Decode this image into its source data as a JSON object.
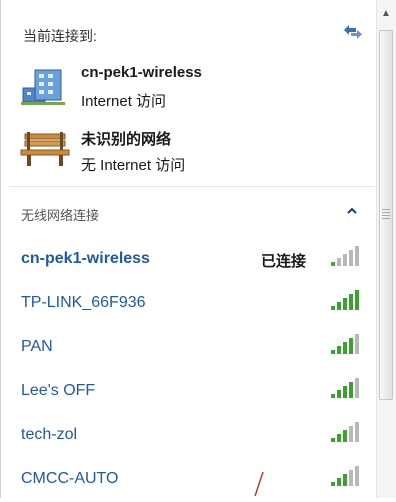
{
  "header": {
    "current_title": "当前连接到:"
  },
  "connections": [
    {
      "name": "cn-pek1-wireless",
      "status": "Internet 访问",
      "icon": "network-building-icon"
    },
    {
      "name": "未识别的网络",
      "status": "无 Internet 访问",
      "icon": "park-bench-icon"
    }
  ],
  "wireless_section": {
    "title": "无线网络连接"
  },
  "networks": [
    {
      "name": "cn-pek1-wireless",
      "status": "已连接",
      "connected": true
    },
    {
      "name": "TP-LINK_66F936",
      "status": "",
      "connected": false
    },
    {
      "name": "PAN",
      "status": "",
      "connected": false
    },
    {
      "name": "Lee's OFF",
      "status": "",
      "connected": false
    },
    {
      "name": "tech-zol",
      "status": "",
      "connected": false
    },
    {
      "name": "CMCC-AUTO",
      "status": "",
      "connected": false
    }
  ],
  "colors": {
    "link": "#1f5aa6",
    "signal_green": "#3aa32e",
    "signal_gray": "#b8b8b8"
  }
}
